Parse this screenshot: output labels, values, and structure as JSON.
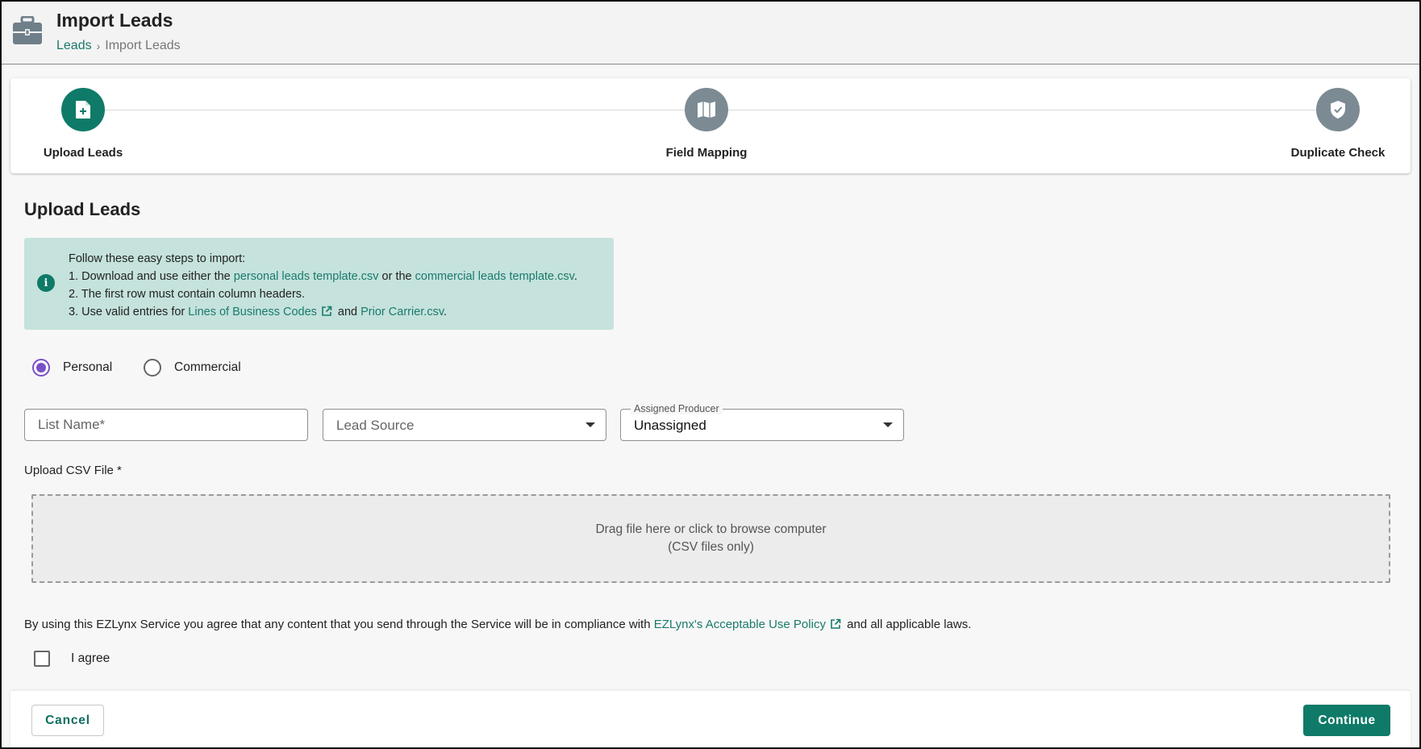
{
  "header": {
    "title": "Import Leads",
    "icon": "briefcase-icon",
    "breadcrumb": {
      "parent": "Leads",
      "separator": "›",
      "current": "Import Leads"
    }
  },
  "stepper": {
    "steps": [
      {
        "label": "Upload Leads",
        "icon": "file-add-icon",
        "active": true
      },
      {
        "label": "Field Mapping",
        "icon": "map-icon",
        "active": false
      },
      {
        "label": "Duplicate Check",
        "icon": "shield-check-icon",
        "active": false
      }
    ]
  },
  "main": {
    "section_title": "Upload Leads",
    "info": {
      "icon": "info-icon",
      "intro": "Follow these easy steps to import:",
      "line1": {
        "prefix": "1. Download and use either the ",
        "link1": "personal leads template.csv",
        "middle": " or the ",
        "link2": "commercial leads template.csv",
        "suffix": "."
      },
      "line2": "2. The first row must contain column headers.",
      "line3": {
        "prefix": "3. Use valid entries for ",
        "link1": "Lines of Business Codes",
        "middle": " and ",
        "link2": "Prior Carrier.csv",
        "suffix": "."
      }
    },
    "lead_type": {
      "options": [
        "Personal",
        "Commercial"
      ],
      "selected": "Personal"
    },
    "fields": {
      "list_name_placeholder": "List Name*",
      "lead_source_placeholder": "Lead Source",
      "assigned_producer_label": "Assigned Producer",
      "assigned_producer_value": "Unassigned"
    },
    "upload": {
      "label": "Upload CSV File *",
      "drop_line1": "Drag file here or click to browse computer",
      "drop_line2": "(CSV files only)"
    },
    "agreement": {
      "prefix": "By using this EZLynx Service you agree that any content that you send through the Service will be in compliance with ",
      "link": "EZLynx's Acceptable Use Policy",
      "suffix": " and all applicable laws.",
      "checkbox_label": "I agree",
      "checked": false
    }
  },
  "footer": {
    "cancel_label": "Cancel",
    "continue_label": "Continue"
  },
  "colors": {
    "accent": "#0f7a68",
    "link": "#1a7a6c",
    "info_bg": "#c5e2dc",
    "step_inactive": "#7c8a93",
    "radio_selected": "#7a4fc9"
  }
}
